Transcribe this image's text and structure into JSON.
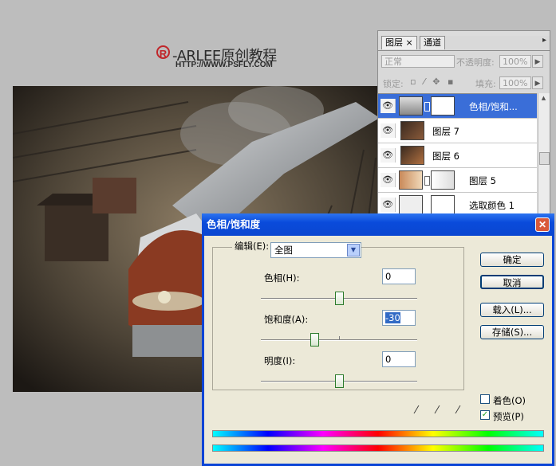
{
  "watermark": {
    "logo": "R",
    "title": "-ARLEE原创教程",
    "url": "HTTP://WWW.PSFLY.COM"
  },
  "layers_panel": {
    "tabs": [
      "图层 ×",
      "通道"
    ],
    "blend_mode": "正常",
    "opacity_label": "不透明度:",
    "opacity_value": "100%",
    "lock_label": "锁定:",
    "fill_label": "填充:",
    "fill_value": "100%",
    "layers": [
      {
        "name": "色相/饱和...",
        "selected": true
      },
      {
        "name": "图层 7"
      },
      {
        "name": "图层 6"
      },
      {
        "name": "图层 5"
      },
      {
        "name": "选取颜色 1"
      }
    ]
  },
  "dialog": {
    "title": "色相/饱和度",
    "edit_label": "编辑(E):",
    "edit_value": "全图",
    "hue_label": "色相(H):",
    "hue_value": "0",
    "saturation_label": "饱和度(A):",
    "saturation_value": "-30",
    "lightness_label": "明度(I):",
    "lightness_value": "0",
    "buttons": {
      "ok": "确定",
      "cancel": "取消",
      "load": "载入(L)...",
      "save": "存储(S)..."
    },
    "colorize_label": "着色(O)",
    "preview_label": "预览(P)",
    "colorize_checked": false,
    "preview_checked": true
  }
}
